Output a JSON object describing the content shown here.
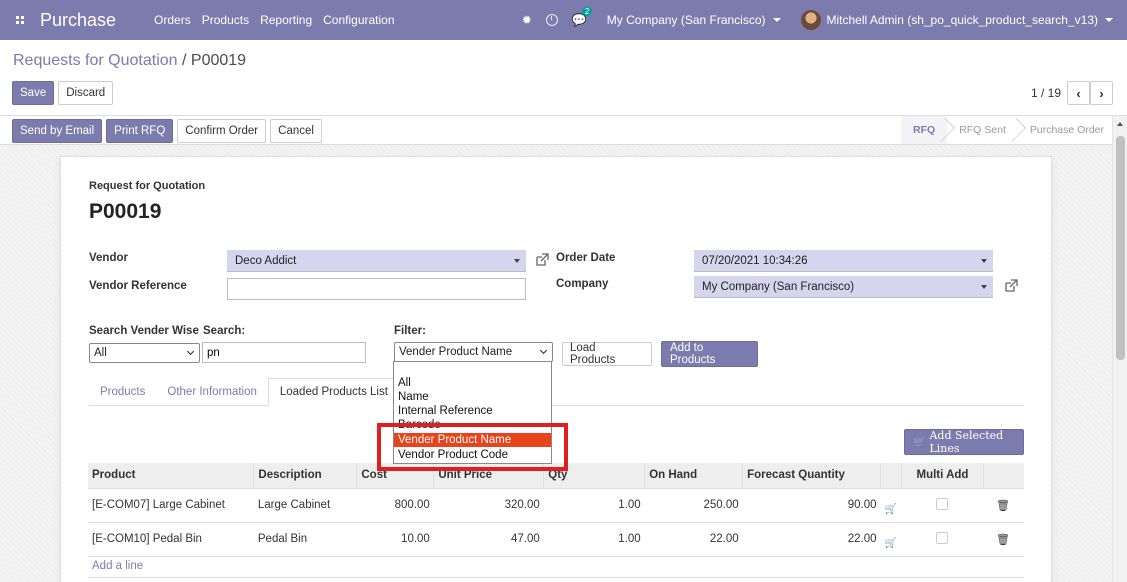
{
  "navbar": {
    "app_title": "Purchase",
    "menus": [
      "Orders",
      "Products",
      "Reporting",
      "Configuration"
    ],
    "chat_count": "2",
    "company": "My Company (San Francisco)",
    "user": "Mitchell Admin (sh_po_quick_product_search_v13)"
  },
  "breadcrumb": {
    "parent": "Requests for Quotation",
    "separator": " / ",
    "current": "P00019"
  },
  "toolbar": {
    "save_label": "Save",
    "discard_label": "Discard",
    "pager": "1 / 19"
  },
  "status_actions": [
    "Send by Email",
    "Print RFQ",
    "Confirm Order",
    "Cancel"
  ],
  "stages": [
    {
      "label": "RFQ",
      "active": true
    },
    {
      "label": "RFQ Sent",
      "active": false
    },
    {
      "label": "Purchase Order",
      "active": false
    }
  ],
  "sheet": {
    "doc_kind": "Request for Quotation",
    "doc_name": "P00019",
    "vendor_label": "Vendor",
    "vendor_value": "Deco Addict",
    "vendor_ref_label": "Vendor Reference",
    "vendor_ref_value": "",
    "order_date_label": "Order Date",
    "order_date_value": "07/20/2021 10:34:26",
    "company_label": "Company",
    "company_value": "My Company (San Francisco)"
  },
  "search": {
    "vendor_wise_label": "Search Vender Wise",
    "vendor_wise_value": "All",
    "search_label": "Search:",
    "search_value": "pn",
    "filter_label": "Filter:",
    "filter_value": "Vender Product Name",
    "load_button": "Load Products",
    "add_button": "Add to Products"
  },
  "filter_options": [
    "All",
    "Name",
    "Internal Reference",
    "Barcode",
    "Vender Product Name",
    "Vendor Product Code"
  ],
  "filter_selected_index": 4,
  "tabs": [
    {
      "label": "Products",
      "active": false
    },
    {
      "label": "Other Information",
      "active": false
    },
    {
      "label": "Loaded Products List",
      "active": true
    }
  ],
  "add_selected_label": "Add Selected Lines",
  "table": {
    "columns": [
      "Product",
      "Description",
      "Cost",
      "Unit Price",
      "Qty",
      "On Hand",
      "Forecast Quantity",
      "Multi Add"
    ],
    "rows": [
      {
        "product": "[E-COM07] Large Cabinet",
        "description": "Large Cabinet",
        "cost": "800.00",
        "unit_price": "320.00",
        "qty": "1.00",
        "on_hand": "250.00",
        "forecast": "90.00"
      },
      {
        "product": "[E-COM10] Pedal Bin",
        "description": "Pedal Bin",
        "cost": "10.00",
        "unit_price": "47.00",
        "qty": "1.00",
        "on_hand": "22.00",
        "forecast": "22.00"
      }
    ],
    "add_line": "Add a line"
  },
  "colors": {
    "brand": "#7c7bad",
    "selected_option": "#e9431c",
    "highlight": "#e02020"
  }
}
